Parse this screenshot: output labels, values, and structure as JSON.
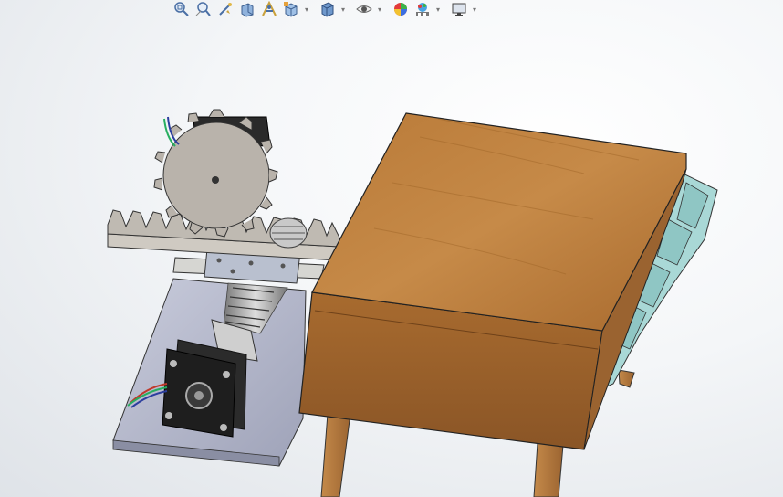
{
  "toolbar": {
    "buttons": [
      {
        "name": "zoom-to-fit-icon"
      },
      {
        "name": "zoom-to-area-icon"
      },
      {
        "name": "previous-view-icon"
      },
      {
        "name": "section-view-icon"
      },
      {
        "name": "dynamic-annotation-icon"
      },
      {
        "name": "view-orientation-icon",
        "has_menu": true
      },
      {
        "name": "display-style-icon",
        "has_menu": true
      },
      {
        "name": "hide-show-items-icon",
        "has_menu": true
      },
      {
        "name": "edit-appearance-icon"
      },
      {
        "name": "apply-scene-icon",
        "has_menu": true
      },
      {
        "name": "view-settings-icon",
        "has_menu": true
      }
    ],
    "caret_glyph": "▾"
  },
  "colors": {
    "wood": "#b87a3e",
    "wood_dark": "#8a5526",
    "metal": "#bfbcb7",
    "plate": "#aeb2c6",
    "glass": "#a9d8d6",
    "motor": "#2b2b2b"
  }
}
